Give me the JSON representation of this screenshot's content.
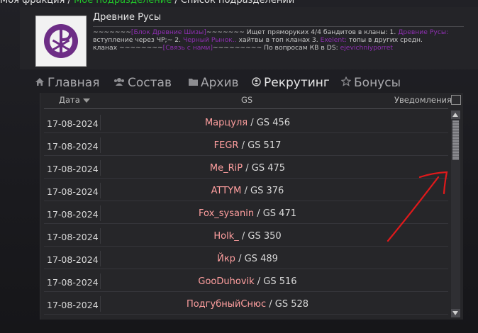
{
  "top_breadcrumb": {
    "part1": "Моя фракция /",
    "part2": "Мое подразделение",
    "part3": "/ Список подразделений"
  },
  "faction": {
    "name": "Древние Русы",
    "desc_line1_a": "~~~~~~~",
    "desc_line1_link": "[Блок Древние Шизы]",
    "desc_line1_b": "~~~~~~~ Ищет пряморуких 4/4 бандитов в кланы: 1.",
    "desc_line1_link2": "Древние Русы:",
    "desc_line2_a": "вступление через ЧР;~ 2.",
    "desc_line2_link": "Черный Рынок..",
    "desc_line2_b": "хайтвы в топ кланах 3.",
    "desc_line2_link2": "Exelent:",
    "desc_line2_c": "топы в других средн.",
    "desc_line3_a": "кланах ~~~~~~~~",
    "desc_line3_link": "[Связь с нами]",
    "desc_line3_b": "~~~~~~~~~ По вопросам КВ в DS:",
    "desc_line3_link2": "ejevichniyporret"
  },
  "nav": {
    "home": "Главная",
    "members": "Состав",
    "archive": "Архив",
    "recruiting": "Рекрутинг",
    "bonuses": "Бонусы"
  },
  "table": {
    "col_date": "Дата",
    "col_gs": "GS",
    "col_notify": "Уведомления:",
    "rows": [
      {
        "date": "17-08-2024",
        "name": "Марцуля",
        "gs": "/ GS 456"
      },
      {
        "date": "17-08-2024",
        "name": "FEGR",
        "gs": "/ GS 517"
      },
      {
        "date": "17-08-2024",
        "name": "Me_RiP",
        "gs": "/ GS 475"
      },
      {
        "date": "17-08-2024",
        "name": "ATTYM",
        "gs": "/ GS 376"
      },
      {
        "date": "17-08-2024",
        "name": "Fox_sysanin",
        "gs": "/ GS 471"
      },
      {
        "date": "17-08-2024",
        "name": "Holk_",
        "gs": "/ GS 350"
      },
      {
        "date": "17-08-2024",
        "name": "Йкр",
        "gs": "/ GS 489"
      },
      {
        "date": "17-08-2024",
        "name": "GooDuhovik",
        "gs": "/ GS 516"
      },
      {
        "date": "17-08-2024",
        "name": "ПодгубныйСнюс",
        "gs": "/ GS 528"
      }
    ]
  },
  "colors": {
    "accent_purple": "#8d2fb0",
    "name_pink": "#ff9f9f",
    "annotation_red": "#e0191b",
    "breadcrumb_green": "#22c12a"
  },
  "icons": {
    "home": "home-icon",
    "members": "users-icon",
    "archive": "folder-icon",
    "recruiting": "recruit-icon",
    "bonuses": "star-icon"
  }
}
